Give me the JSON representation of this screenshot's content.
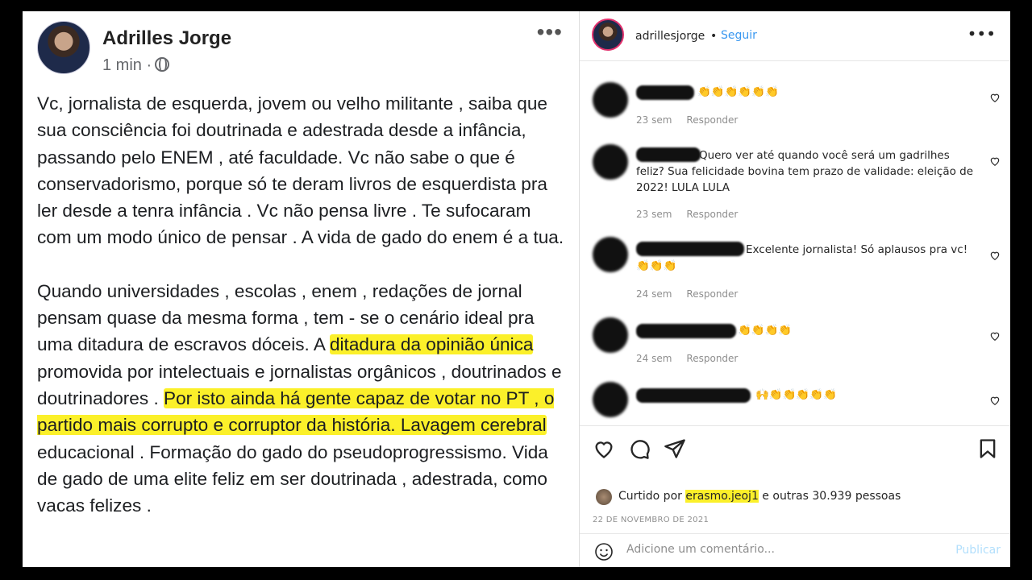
{
  "facebook": {
    "author": "Adrilles Jorge",
    "time": "1 min ·",
    "paragraph1": "Vc, jornalista de esquerda, jovem ou velho militante , saiba que sua consciência foi doutrinada e adestrada desde a infância, passando pelo ENEM , até  faculdade. Vc não sabe o que é conservadorismo, porque só te deram livros de esquerdista pra ler desde a tenra infância . Vc não pensa livre . Te sufocaram com um modo único de pensar . A vida de gado do enem é a tua.",
    "p2_part1": "Quando universidades , escolas , enem , redações de jornal pensam quase da mesma  forma , tem - se o cenário ideal pra uma ditadura de escravos dóceis. A ",
    "p2_highlight1": "ditadura da opinião única ",
    "p2_part2": "promovida por intelectuais e jornalistas orgânicos , doutrinados e doutrinadores . ",
    "p2_highlight2": "Por isto ainda há gente capaz de votar no PT , o partido mais corrupto e corruptor da história. Lavagem cerebral ",
    "p2_part3": "educacional . Formação do gado do pseudoprogressismo. Vida de gado de uma elite feliz em ser doutrinada , adestrada, como vacas felizes ."
  },
  "instagram": {
    "username": "adrillesjorge",
    "dot": "•",
    "follow": "Seguir",
    "comments": [
      {
        "text": "👏👏👏👏👏👏",
        "time": "23 sem",
        "reply": "Responder"
      },
      {
        "text": "Quero ver até quando você será um gadrilhes feliz? Sua felicidade bovina tem prazo de validade: eleição de 2022! LULA LULA",
        "time": "23 sem",
        "reply": "Responder"
      },
      {
        "text": "Excelente jornalista! Só aplausos pra vc! 👏👏👏",
        "time": "24 sem",
        "reply": "Responder"
      },
      {
        "text": "👏👏👏👏",
        "time": "24 sem",
        "reply": "Responder"
      },
      {
        "text": "🙌👏👏👏👏👏",
        "time": "24 sem",
        "reply": "Responder"
      }
    ],
    "liked_prefix": "Curtido por ",
    "liked_user": "erasmo.jeoj1",
    "liked_suffix": " e outras 30.939 pessoas",
    "date": "22 DE NOVEMBRO DE 2021",
    "comment_placeholder": "Adicione um comentário...",
    "publish": "Publicar"
  },
  "colors": {
    "highlight": "#fbf02a",
    "link": "#3897f0",
    "publish_disabled": "#b2dffc"
  }
}
